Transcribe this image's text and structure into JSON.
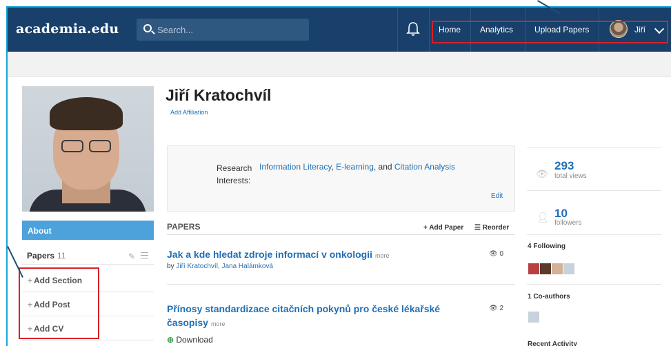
{
  "topbar": {
    "logo": "academia.edu",
    "search_placeholder": "Search...",
    "nav": [
      "Home",
      "Analytics",
      "Upload Papers"
    ],
    "user": "Jiří"
  },
  "profile": {
    "name": "Jiří Kratochvíl",
    "add_affiliation": "Add Affiliation"
  },
  "sidebar": {
    "about": "About",
    "papers_label": "Papers",
    "papers_count": "11",
    "add_items": [
      "Add Section",
      "Add Post",
      "Add CV"
    ]
  },
  "interests": {
    "label": "Research Interests:",
    "items": [
      "Information Literacy",
      "E-learning",
      "Citation Analysis"
    ],
    "sep1": ", ",
    "sep2": ", and ",
    "edit": "Edit"
  },
  "papers": {
    "header": "PAPERS",
    "add_paper": "Add Paper",
    "reorder": "Reorder",
    "more": "more",
    "list": [
      {
        "title": "Jak a kde hledat zdroje informací v onkologii",
        "by": "by",
        "authors": "Jiří Kratochvíl, Jana Halámková",
        "views": "0"
      },
      {
        "title_line1": "Přínosy standardizace citačních pokynů pro české lékařské",
        "title_line2": "časopisy",
        "views": "2",
        "download": "Download"
      }
    ]
  },
  "stats": {
    "views_num": "293",
    "views_label": "total views",
    "followers_num": "10",
    "followers_label": "followers",
    "following": "4 Following",
    "coauthors": "1 Co-authors",
    "recent": "Recent Activity"
  },
  "colors": {
    "topbar": "#18406b",
    "accent": "#1f6fb5",
    "about_bg": "#4da2dc",
    "highlight_box": "#d6222a",
    "callout": "#1aa3d8"
  }
}
